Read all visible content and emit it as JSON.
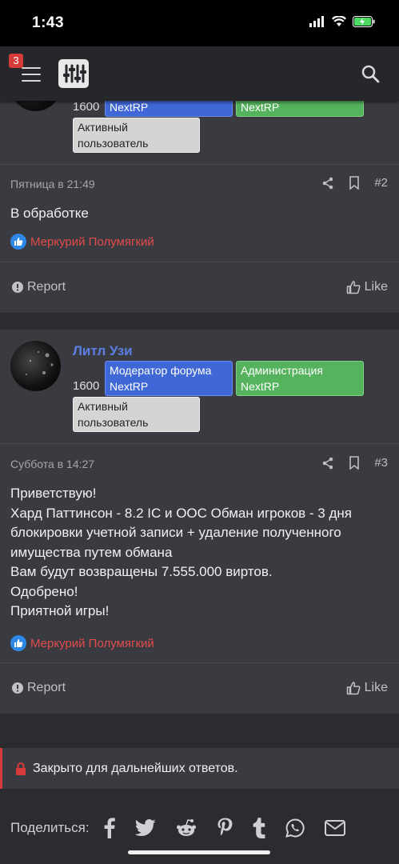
{
  "status_bar": {
    "time": "1:43"
  },
  "navbar": {
    "notification_count": "3"
  },
  "post1": {
    "user_count": "1600",
    "badge_blue": "NextRP",
    "badge_green": "NextRP",
    "badge_gray_line1": "Активный",
    "badge_gray_line2": "пользователь",
    "date": "Пятница в 21:49",
    "number": "#2",
    "text": "В обработке",
    "reaction_user": "Меркурий Полумягкий",
    "report_label": "Report",
    "like_label": "Like"
  },
  "post2": {
    "username": "Литл Узи",
    "user_count": "1600",
    "badge_blue_line1": "Модератор форума",
    "badge_blue_line2": "NextRP",
    "badge_green_line1": "Администрация",
    "badge_green_line2": "NextRP",
    "badge_gray_line1": "Активный",
    "badge_gray_line2": "пользователь",
    "date": "Суббота в 14:27",
    "number": "#3",
    "lines": [
      "Приветствую!",
      "Хард Паттинсон - 8.2 IC и OOC Обман игроков - 3 дня",
      "блокировки учетной записи + удаление полученного",
      "имущества путем обмана",
      "Вам будут возвращены 7.555.000 виртов.",
      "Одобрено!",
      "Приятной игры!"
    ],
    "reaction_user": "Меркурий Полумягкий",
    "report_label": "Report",
    "like_label": "Like"
  },
  "locked_notice": "Закрыто для дальнейших ответов.",
  "share": {
    "label": "Поделиться:",
    "icons": [
      "facebook-icon",
      "twitter-icon",
      "reddit-icon",
      "pinterest-icon",
      "tumblr-icon",
      "whatsapp-icon",
      "email-icon"
    ]
  },
  "colors": {
    "accent_blue": "#3f68d6",
    "accent_green": "#55b35d",
    "reaction_red": "#e24b4b",
    "username_blue": "#5b7fe4"
  }
}
